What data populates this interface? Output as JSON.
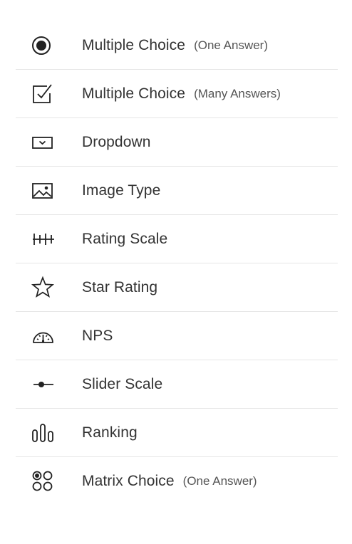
{
  "question_types": {
    "items": [
      {
        "label": "Multiple Choice",
        "sub": "(One Answer)",
        "icon": "radio-button-icon"
      },
      {
        "label": "Multiple Choice",
        "sub": "(Many Answers)",
        "icon": "checkbox-icon"
      },
      {
        "label": "Dropdown",
        "sub": "",
        "icon": "dropdown-icon"
      },
      {
        "label": "Image Type",
        "sub": "",
        "icon": "image-icon"
      },
      {
        "label": "Rating Scale",
        "sub": "",
        "icon": "rating-scale-icon"
      },
      {
        "label": "Star Rating",
        "sub": "",
        "icon": "star-icon"
      },
      {
        "label": "NPS",
        "sub": "",
        "icon": "gauge-icon"
      },
      {
        "label": "Slider Scale",
        "sub": "",
        "icon": "slider-icon"
      },
      {
        "label": "Ranking",
        "sub": "",
        "icon": "ranking-icon"
      },
      {
        "label": "Matrix Choice",
        "sub": "(One Answer)",
        "icon": "matrix-icon"
      }
    ]
  },
  "colors": {
    "text": "#333333",
    "icon": "#222222",
    "divider": "#e6e6e6"
  }
}
